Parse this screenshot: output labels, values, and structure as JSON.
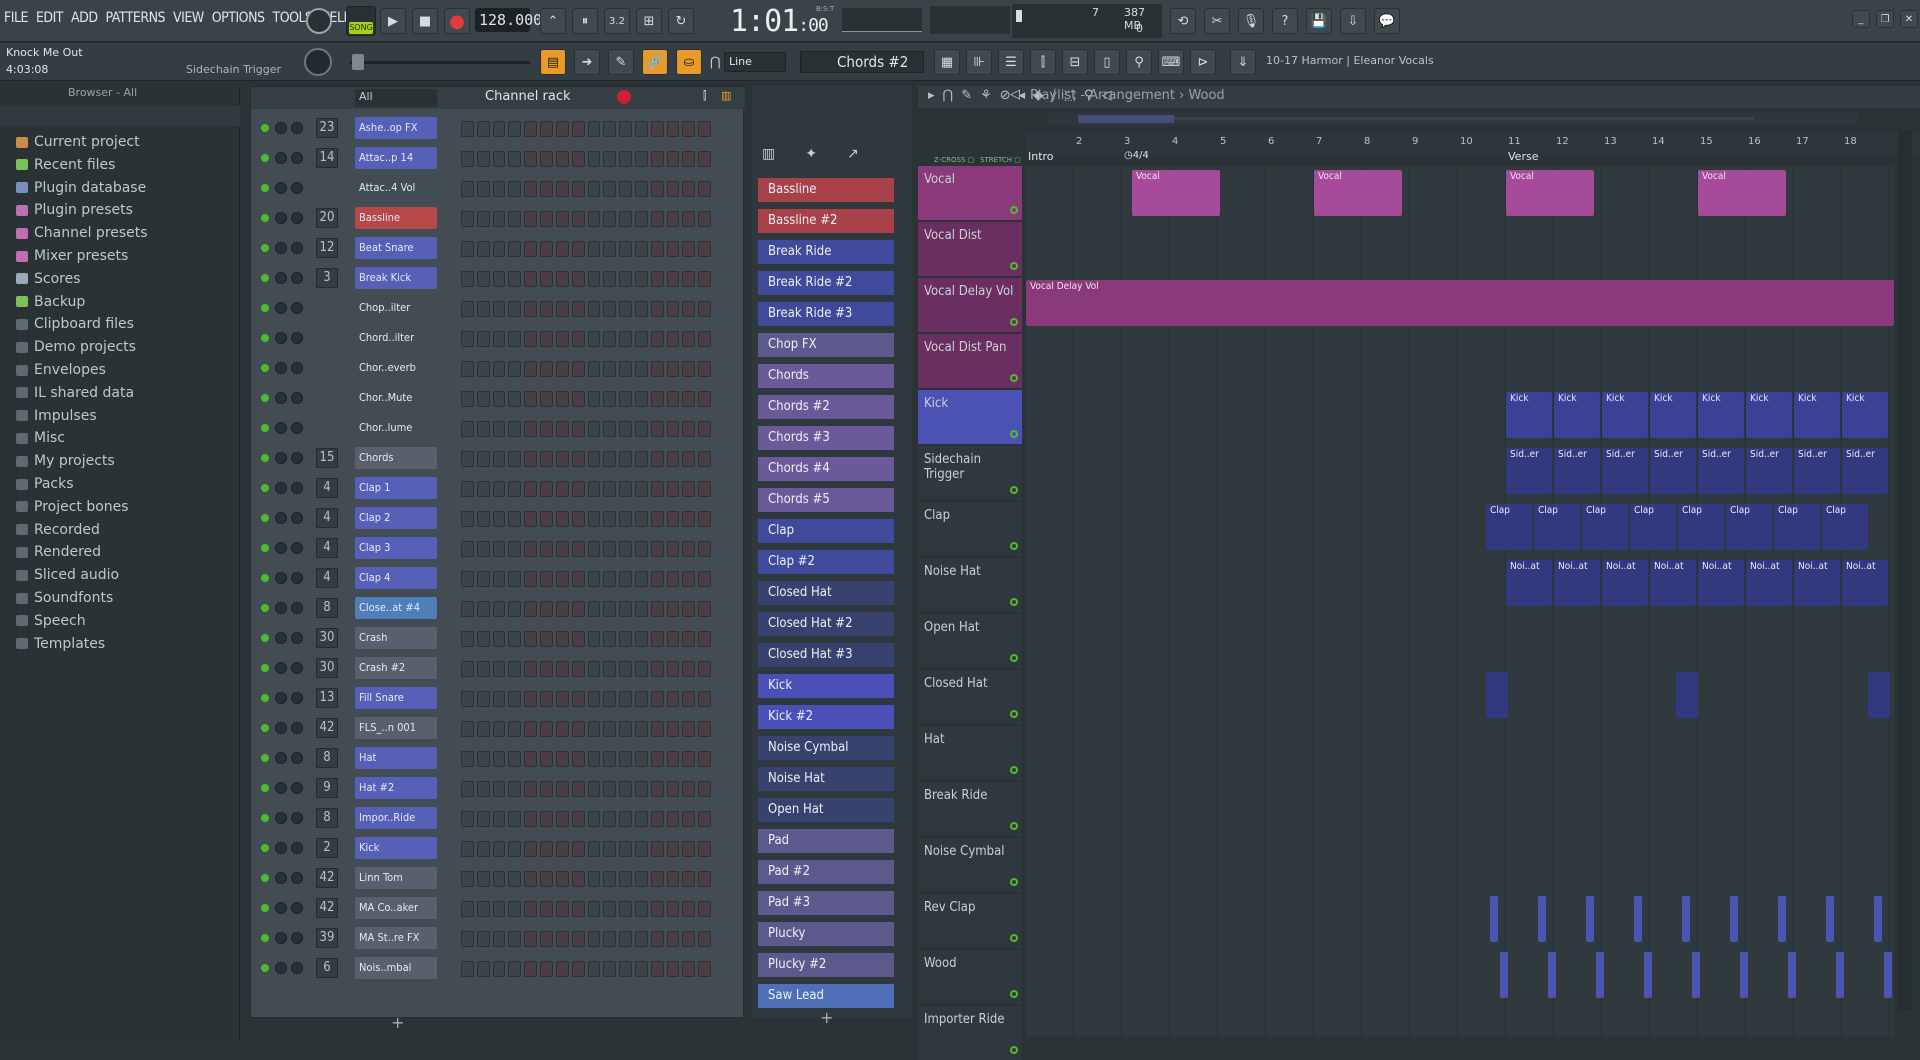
{
  "menu": [
    "FILE",
    "EDIT",
    "ADD",
    "PATTERNS",
    "VIEW",
    "OPTIONS",
    "TOOLS",
    "HELP"
  ],
  "transport": {
    "mode_label": "SONG",
    "bpm": "128.000",
    "time": "1:01",
    "time_small": ":00",
    "bst": "B:S:T",
    "cpu": "7",
    "mem": "387 MB",
    "poly": "0"
  },
  "project": {
    "name": "Knock Me Out",
    "length": "4:03:08",
    "hint": "Sidechain Trigger"
  },
  "toolbar": {
    "snap": "Line",
    "pattern": "Chords #2",
    "news": "10-17  Harmor | Eleanor Vocals"
  },
  "browser": {
    "title": "Browser - All",
    "items": [
      "Current project",
      "Recent files",
      "Plugin database",
      "Plugin presets",
      "Channel presets",
      "Mixer presets",
      "Scores",
      "Backup",
      "Clipboard files",
      "Demo projects",
      "Envelopes",
      "IL shared data",
      "Impulses",
      "Misc",
      "My projects",
      "Packs",
      "Project bones",
      "Recorded",
      "Rendered",
      "Sliced audio",
      "Soundfonts",
      "Speech",
      "Templates"
    ]
  },
  "rack": {
    "title": "Channel rack",
    "filter": "All",
    "channels": [
      {
        "n": "23",
        "name": "Ashe..op FX",
        "c": "#5660b8"
      },
      {
        "n": "14",
        "name": "Attac..p 14",
        "c": "#5660b8"
      },
      {
        "n": "",
        "name": "Attac..4 Vol",
        "c": "#424c52"
      },
      {
        "n": "20",
        "name": "Bassline",
        "c": "#b54848"
      },
      {
        "n": "12",
        "name": "Beat Snare",
        "c": "#5660b8"
      },
      {
        "n": "3",
        "name": "Break Kick",
        "c": "#5660b8"
      },
      {
        "n": "",
        "name": "Chop..ilter",
        "c": "#424c52"
      },
      {
        "n": "",
        "name": "Chord..ilter",
        "c": "#424c52"
      },
      {
        "n": "",
        "name": "Chor..everb",
        "c": "#424c52"
      },
      {
        "n": "",
        "name": "Chor..Mute",
        "c": "#424c52"
      },
      {
        "n": "",
        "name": "Chor..lume",
        "c": "#424c52"
      },
      {
        "n": "15",
        "name": "Chords",
        "c": "#5a5f6e"
      },
      {
        "n": "4",
        "name": "Clap 1",
        "c": "#5660b8"
      },
      {
        "n": "4",
        "name": "Clap 2",
        "c": "#5660b8"
      },
      {
        "n": "4",
        "name": "Clap 3",
        "c": "#5660b8"
      },
      {
        "n": "4",
        "name": "Clap 4",
        "c": "#5660b8"
      },
      {
        "n": "8",
        "name": "Close..at #4",
        "c": "#4f7fb8"
      },
      {
        "n": "30",
        "name": "Crash",
        "c": "#5a5f6e"
      },
      {
        "n": "30",
        "name": "Crash #2",
        "c": "#5a5f6e"
      },
      {
        "n": "13",
        "name": "Fill Snare",
        "c": "#5660b8"
      },
      {
        "n": "42",
        "name": "FLS_..n 001",
        "c": "#5a5f6e"
      },
      {
        "n": "8",
        "name": "Hat",
        "c": "#5660b8"
      },
      {
        "n": "9",
        "name": "Hat #2",
        "c": "#5660b8"
      },
      {
        "n": "8",
        "name": "Impor..Ride",
        "c": "#5660b8"
      },
      {
        "n": "2",
        "name": "Kick",
        "c": "#5660b8"
      },
      {
        "n": "42",
        "name": "Linn Tom",
        "c": "#5a5f6e"
      },
      {
        "n": "42",
        "name": "MA Co..aker",
        "c": "#5a5f6e"
      },
      {
        "n": "39",
        "name": "MA St..re FX",
        "c": "#5a5f6e"
      },
      {
        "n": "6",
        "name": "Nois..mbal",
        "c": "#5a5f6e"
      }
    ]
  },
  "patterns": [
    {
      "name": "Bassline",
      "c": "#a8414a"
    },
    {
      "name": "Bassline #2",
      "c": "#a8414a"
    },
    {
      "name": "Break Ride",
      "c": "#3f4a9a"
    },
    {
      "name": "Break Ride #2",
      "c": "#3f4a9a"
    },
    {
      "name": "Break Ride #3",
      "c": "#3f4a9a"
    },
    {
      "name": "Chop FX",
      "c": "#5c5a8c"
    },
    {
      "name": "Chords",
      "c": "#6a5a9a"
    },
    {
      "name": "Chords #2",
      "c": "#6a5a9a"
    },
    {
      "name": "Chords #3",
      "c": "#6a5a9a"
    },
    {
      "name": "Chords #4",
      "c": "#6a5a9a"
    },
    {
      "name": "Chords #5",
      "c": "#6a5a9a"
    },
    {
      "name": "Clap",
      "c": "#3f4a9a"
    },
    {
      "name": "Clap #2",
      "c": "#3f4a9a"
    },
    {
      "name": "Closed Hat",
      "c": "#37426e"
    },
    {
      "name": "Closed Hat #2",
      "c": "#37426e"
    },
    {
      "name": "Closed Hat #3",
      "c": "#37426e"
    },
    {
      "name": "Kick",
      "c": "#4a50b8"
    },
    {
      "name": "Kick #2",
      "c": "#4a50b8"
    },
    {
      "name": "Noise Cymbal",
      "c": "#37426e"
    },
    {
      "name": "Noise Hat",
      "c": "#37426e"
    },
    {
      "name": "Open Hat",
      "c": "#37426e"
    },
    {
      "name": "Pad",
      "c": "#5c5a8c"
    },
    {
      "name": "Pad #2",
      "c": "#5c5a8c"
    },
    {
      "name": "Pad #3",
      "c": "#5c5a8c"
    },
    {
      "name": "Plucky",
      "c": "#5c5a8c"
    },
    {
      "name": "Plucky #2",
      "c": "#5c5a8c"
    },
    {
      "name": "Saw Lead",
      "c": "#4f6fb8"
    }
  ],
  "playlist": {
    "title": "Playlist - Arrangement",
    "sub": "Wood",
    "markers": [
      "Intro",
      "Verse"
    ],
    "timesig": "4/4",
    "bars": [
      "2",
      "3",
      "4",
      "5",
      "6",
      "7",
      "8",
      "9",
      "10",
      "11",
      "12",
      "13",
      "14",
      "15",
      "16",
      "17",
      "18"
    ],
    "tracks": [
      "Vocal",
      "Vocal Dist",
      "Vocal Delay Vol",
      "Vocal Dist Pan",
      "Kick",
      "Sidechain Trigger",
      "Clap",
      "Noise Hat",
      "Open Hat",
      "Closed Hat",
      "Hat",
      "Break Ride",
      "Noise Cymbal",
      "Rev Clap",
      "Wood",
      "Importer Ride"
    ],
    "clip_labels": {
      "vocal": "Vocal",
      "delay": "Vocal Delay Vol",
      "kick": "Kick",
      "side": "Sid..er",
      "clap": "Clap",
      "noise": "Noi..at"
    }
  }
}
